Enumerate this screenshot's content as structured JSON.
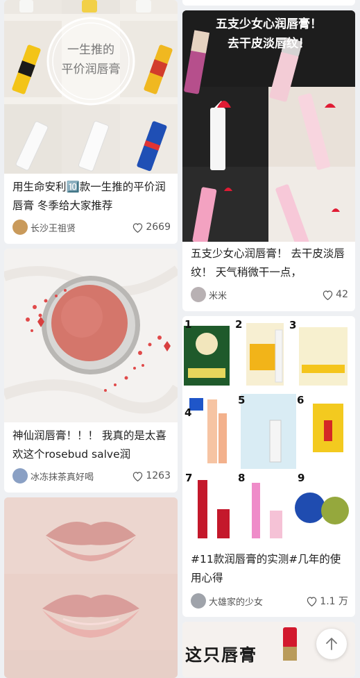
{
  "feed": {
    "posts": [
      {
        "cover_text": "一生推的\n平价润唇膏",
        "title": "用生命安利🔟款一生推的平价润唇膏 冬季给大家推荐",
        "author": "长沙王祖贤",
        "likes": "2669"
      },
      {
        "title": "神仙润唇膏！！！ 我真的是太喜欢这个rosebud salve润",
        "author": "冰冻抹茶真好喝",
        "likes": "1263"
      },
      {
        "cover_text": "五支少女心润唇膏！\n去干皮淡唇纹！",
        "title": "五支少女心润唇膏！ 去干皮淡唇纹！ 天气稍微干一点，",
        "author": "米米",
        "likes": "42"
      },
      {
        "grid_numbers": [
          "1",
          "2",
          "3",
          "4",
          "5",
          "6",
          "7",
          "8",
          "9"
        ],
        "title": "#11款润唇膏的实测#几年的使用心得",
        "author": "大雄家的少女",
        "likes": "1.1 万"
      },
      {
        "cover_text": "这只唇膏"
      }
    ]
  },
  "colors": {
    "background": "#eef0f3",
    "card": "#ffffff",
    "text": "#1e1e1e",
    "muted": "#555555"
  },
  "icons": {
    "like": "heart-outline-icon",
    "back_to_top": "arrow-up-icon"
  }
}
